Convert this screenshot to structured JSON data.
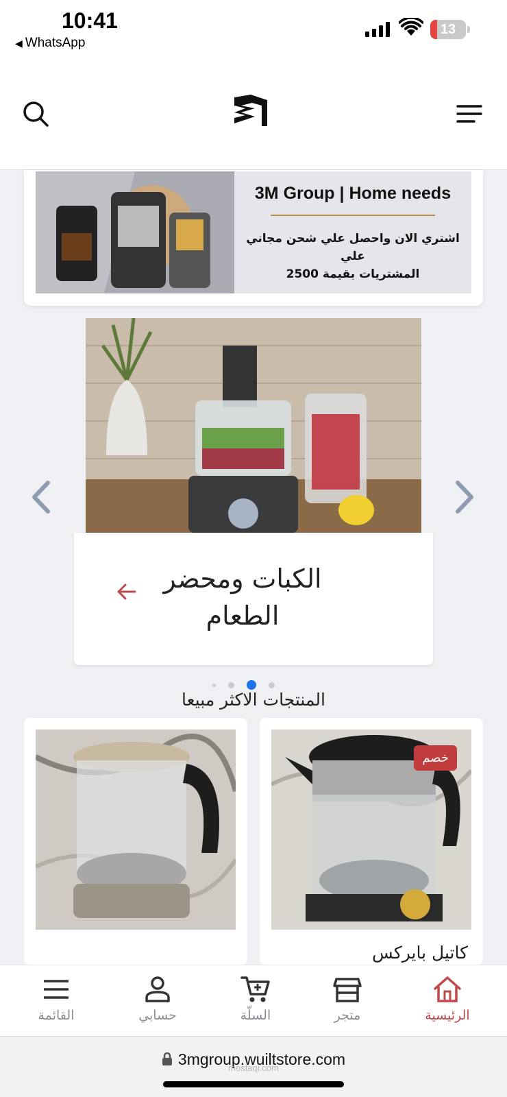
{
  "status_bar": {
    "time": "10:41",
    "back_app": "WhatsApp",
    "battery": "13"
  },
  "header": {
    "search_icon": "search-icon",
    "logo": "3m-logo",
    "menu_icon": "menu-icon"
  },
  "promo": {
    "title": "3M Group | Home needs",
    "subtitle_line1": "اشتري الان واحصل علي شحن مجاني علي",
    "subtitle_line2": "المشتريات بقيمة 2500"
  },
  "slider": {
    "title_line1": "الكبات ومحضر",
    "title_line2": "الطعام",
    "dots_count": 4,
    "active_dot": 2
  },
  "best_sellers": {
    "title": "المنتجات الاكثر مبيعا",
    "products": [
      {
        "name": "كاتيل بايركس",
        "badge": "خصم"
      },
      {
        "name": "",
        "badge": ""
      }
    ]
  },
  "bottom_nav": {
    "items": [
      {
        "label": "الرئيسية",
        "icon": "home-icon",
        "active": true
      },
      {
        "label": "متجر",
        "icon": "store-icon",
        "active": false
      },
      {
        "label": "السلّة",
        "icon": "cart-icon",
        "active": false
      },
      {
        "label": "حسابي",
        "icon": "account-icon",
        "active": false
      },
      {
        "label": "القائمة",
        "icon": "list-menu-icon",
        "active": false
      }
    ]
  },
  "browser": {
    "url": "3mgroup.wuiltstore.com",
    "watermark": "mostaqi.com"
  },
  "colors": {
    "accent": "#c0494c",
    "dot_active": "#1a73e8",
    "badge": "#c13d3d"
  }
}
